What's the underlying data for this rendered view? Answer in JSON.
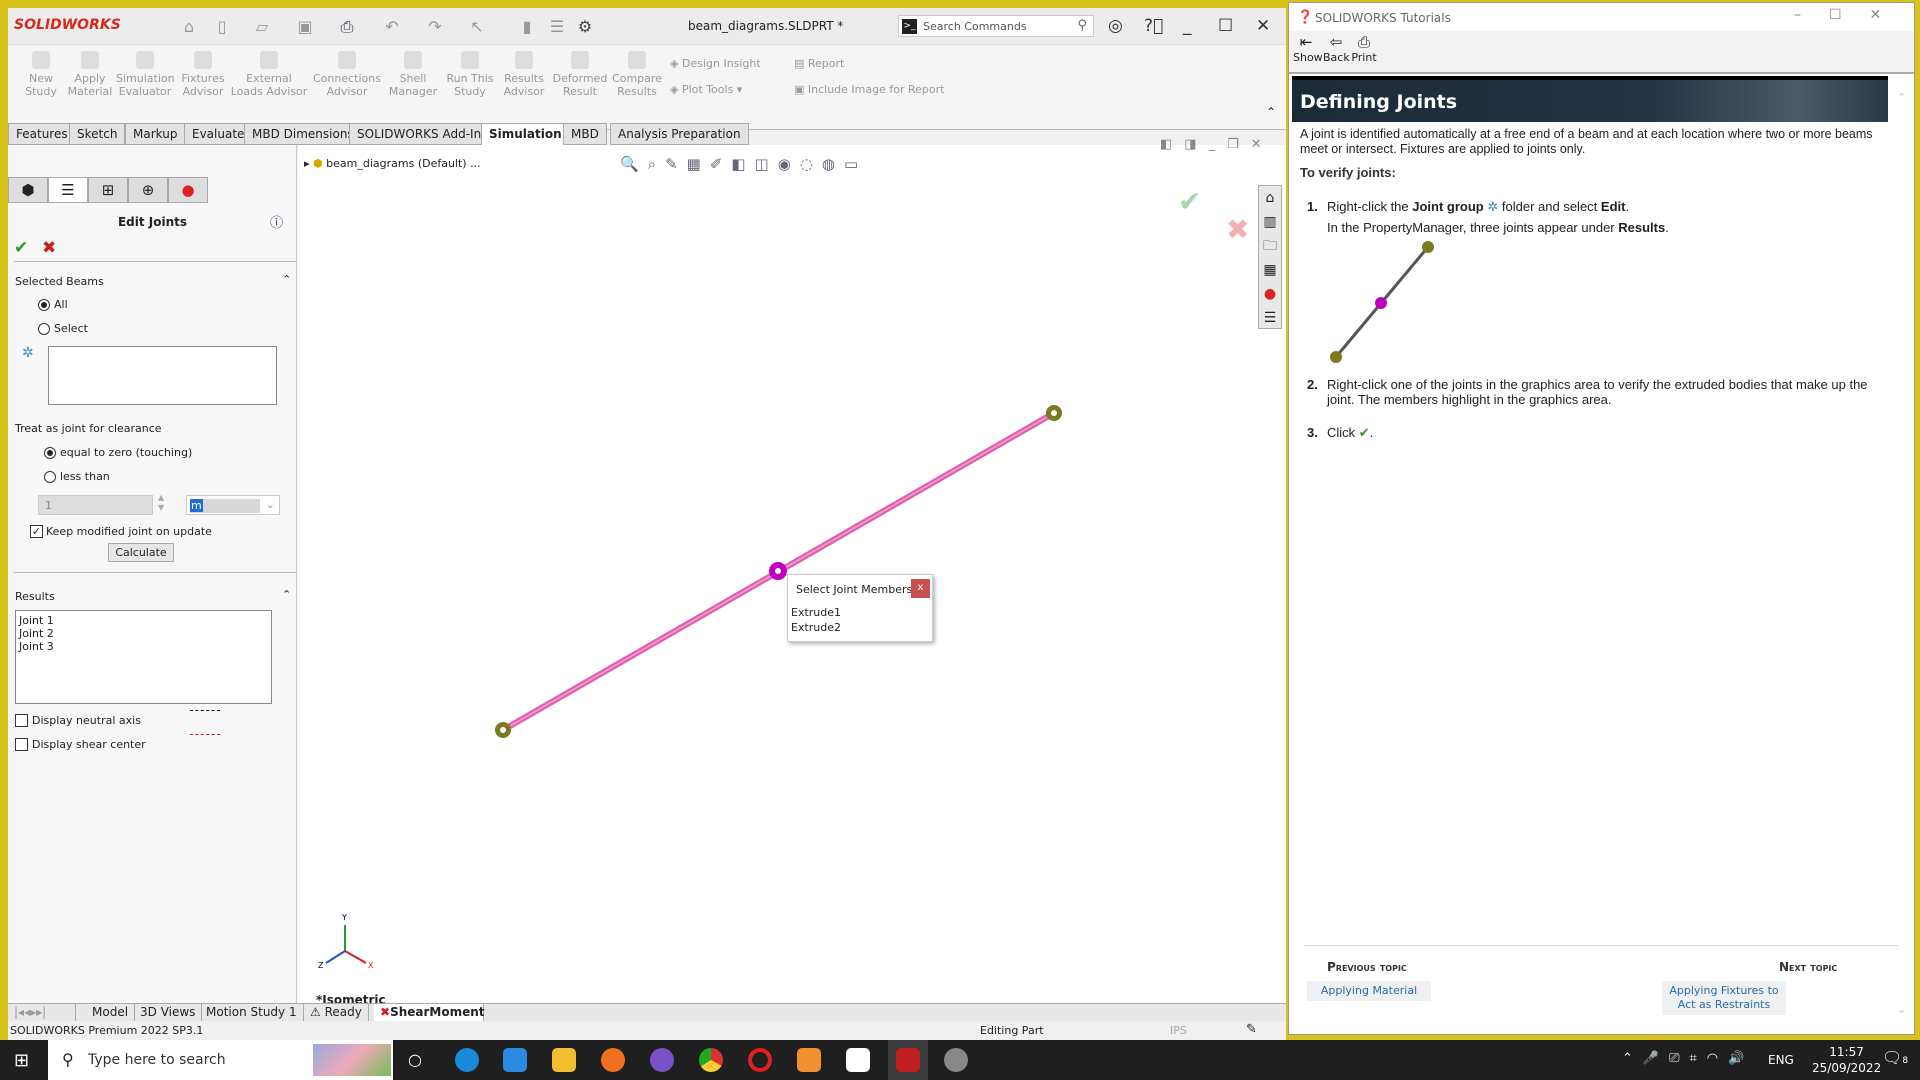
{
  "app": {
    "logo": "SOLIDWORKS",
    "doc_title": "beam_diagrams.SLDPRT *",
    "search_placeholder": "Search Commands"
  },
  "ribbon": {
    "buttons": [
      "New Study",
      "Apply Material",
      "Simulation Evaluator",
      "Fixtures Advisor",
      "External Loads Advisor",
      "Connections Advisor",
      "Shell Manager",
      "Run This Study",
      "Results Advisor",
      "Deformed Result",
      "Compare Results"
    ],
    "small": [
      "Design Insight",
      "Plot Tools",
      "Report",
      "Include Image for Report"
    ]
  },
  "tabs": [
    "Features",
    "Sketch",
    "Markup",
    "Evaluate",
    "MBD Dimensions",
    "SOLIDWORKS Add-Ins",
    "Simulation",
    "MBD",
    "Analysis Preparation"
  ],
  "active_tab": "Simulation",
  "pm": {
    "title": "Edit Joints",
    "selected_beams": "Selected Beams",
    "all": "All",
    "select": "Select",
    "treat": "Treat as joint for clearance",
    "equal": "equal to zero (touching)",
    "less": "less than",
    "value": "1",
    "unit": "m",
    "keep": "Keep modified joint on update",
    "calculate": "Calculate",
    "results": "Results",
    "joints": [
      "Joint 1",
      "Joint 2",
      "Joint 3"
    ],
    "neutral": "Display neutral axis",
    "shear": "Display shear center",
    "colors": {
      "neutral": "#000000",
      "shear": "#d01010"
    }
  },
  "tree": {
    "root": "beam_diagrams  (Default) ..."
  },
  "graphics": {
    "view": "*Isometric",
    "beam_color": "#e060b0",
    "joint_color": "#7a7a1e",
    "selected_joint_color": "#c000c0"
  },
  "popup": {
    "title": "Select Joint Members",
    "close": "x",
    "items": [
      "Extrude1",
      "Extrude2"
    ]
  },
  "bottom_tabs": [
    "Model",
    "3D Views",
    "Motion Study 1",
    "Ready",
    "ShearMoment"
  ],
  "status": {
    "product": "SOLIDWORKS Premium 2022 SP3.1",
    "mode": "Editing Part",
    "units": "IPS"
  },
  "tutorial": {
    "window_title": "SOLIDWORKS Tutorials",
    "toolbar": [
      "Show",
      "Back",
      "Print"
    ],
    "heading": "Defining Joints",
    "intro": "A joint is identified automatically at a free end of a beam and at each location where two or more beams meet or intersect. Fixtures are applied to joints only.",
    "verify": "To verify joints:",
    "step1_pre": "Right-click the ",
    "step1_b1": "Joint group",
    "step1_mid": " folder and select ",
    "step1_b2": "Edit",
    "step1_end": ".",
    "step1_sub_pre": "In the PropertyManager, three joints appear under ",
    "step1_sub_b": "Results",
    "step1_sub_end": ".",
    "step2": "Right-click one of the joints in the graphics area to verify the extruded bodies that make up the joint. The members highlight in the graphics area.",
    "step3": "Click",
    "step3_end": ".",
    "prev_label": "Previous topic",
    "prev_link": "Applying Material",
    "next_label": "Next topic",
    "next_link": "Applying Fixtures to Act as Restraints"
  },
  "taskbar": {
    "search_placeholder": "Type here to search",
    "lang": "ENG",
    "time": "11:57",
    "date": "25/09/2022",
    "notifications": "8"
  }
}
